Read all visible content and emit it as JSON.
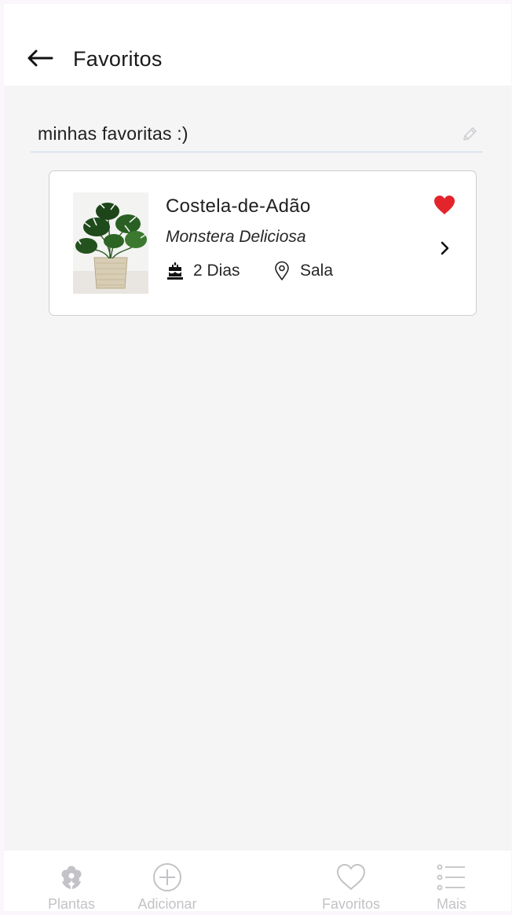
{
  "header": {
    "title": "Favoritos",
    "back_icon": "arrow-left-icon"
  },
  "list": {
    "name": "minhas favoritas :)",
    "edit_icon": "pencil-icon"
  },
  "plants": [
    {
      "name": "Costela-de-Adão",
      "scientific_name": "Monstera Deliciosa",
      "age": "2 Dias",
      "age_icon": "birthday-cake-icon",
      "location": "Sala",
      "location_icon": "map-pin-icon",
      "favorite": true,
      "favorite_color": "#e3252b"
    }
  ],
  "bottom_nav": {
    "items": [
      {
        "label": "Plantas",
        "icon": "flower-icon"
      },
      {
        "label": "Adicionar",
        "icon": "plus-circle-icon"
      },
      {
        "label": "Favoritos",
        "icon": "heart-outline-icon"
      },
      {
        "label": "Mais",
        "icon": "list-icon"
      }
    ]
  },
  "colors": {
    "background": "#f5f5f6",
    "header": "#ffffff",
    "divider": "#c9d6e6",
    "nav_inactive": "#c3c3c7",
    "favorite": "#e3252b"
  }
}
